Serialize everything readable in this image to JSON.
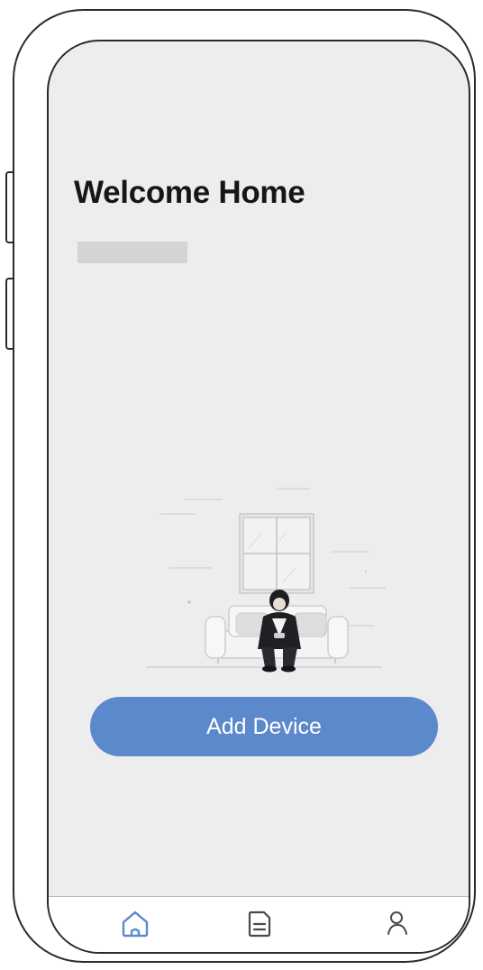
{
  "home": {
    "title": "Welcome Home",
    "add_device_label": "Add Device"
  },
  "tabbar": {
    "items": [
      {
        "icon": "home-icon",
        "active": true
      },
      {
        "icon": "document-icon",
        "active": false
      },
      {
        "icon": "user-icon",
        "active": false
      }
    ]
  },
  "colors": {
    "accent": "#5b89cb",
    "screen_background": "#ededee",
    "active_icon": "#5b89cb",
    "inactive_icon": "#4a4a4a"
  }
}
